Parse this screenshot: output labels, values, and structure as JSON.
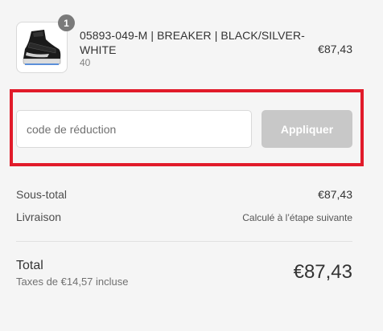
{
  "product": {
    "quantity": "1",
    "title": "05893-049-M | BREAKER | BLACK/SILVER-WHITE",
    "variant": "40",
    "price": "€87,43",
    "image_icon": "sneaker-icon"
  },
  "discount": {
    "placeholder": "code de réduction",
    "value": "",
    "apply_label": "Appliquer",
    "highlight_color": "#e11b2a"
  },
  "summary": {
    "subtotal_label": "Sous-total",
    "subtotal_value": "€87,43",
    "shipping_label": "Livraison",
    "shipping_value": "Calculé à l’étape suivante"
  },
  "total": {
    "label": "Total",
    "taxes": "Taxes de €14,57 incluse",
    "value": "€87,43"
  }
}
